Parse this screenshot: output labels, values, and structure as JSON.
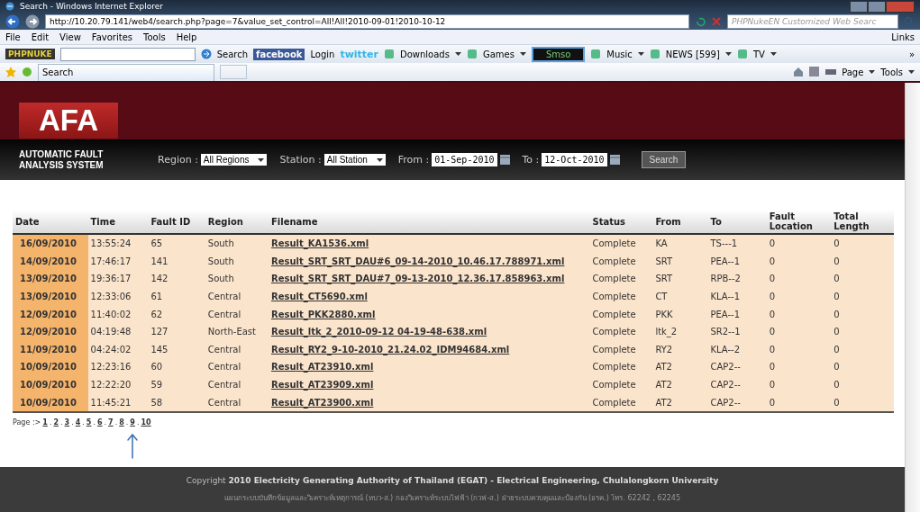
{
  "window": {
    "title": "Search - Windows Internet Explorer"
  },
  "address_bar": {
    "url": "http://10.20.79.141/web4/search.php?page=7&value_set_control=All!All!2010-09-01!2010-10-12",
    "search_placeholder": "PHPNukeEN Customized Web Searc"
  },
  "menu": [
    "File",
    "Edit",
    "View",
    "Favorites",
    "Tools",
    "Help"
  ],
  "menu_links": "Links",
  "toolbar": {
    "logo": "PHPNUKE",
    "items": [
      {
        "kind": "search",
        "label": "Search"
      },
      {
        "kind": "facebook",
        "label": "facebook"
      },
      {
        "kind": "text",
        "label": "Login"
      },
      {
        "kind": "twitter",
        "label": "twitter"
      },
      {
        "kind": "menu",
        "label": "Downloads"
      },
      {
        "kind": "menu",
        "label": "Games"
      },
      {
        "kind": "radio",
        "label": "Smso"
      },
      {
        "kind": "menu",
        "label": "Music"
      },
      {
        "kind": "menu",
        "label": "NEWS [599]"
      },
      {
        "kind": "menu",
        "label": "TV"
      }
    ],
    "more": "»"
  },
  "tab": {
    "label": "Search"
  },
  "command_bar": [
    "Page",
    "Tools"
  ],
  "header": {
    "logo": "AFA",
    "subtitle": "AUTOMATIC FAULT ANALYSIS SYSTEM",
    "filters": [
      {
        "label": "Region :",
        "kind": "select",
        "value": "All Regions"
      },
      {
        "label": "Station :",
        "kind": "select",
        "value": "All Station"
      },
      {
        "label": "From :",
        "kind": "date",
        "value": "01-Sep-2010"
      },
      {
        "label": "To :",
        "kind": "date",
        "value": "12-Oct-2010"
      }
    ],
    "search_button": "Search"
  },
  "table": {
    "columns": [
      "Date",
      "Time",
      "Fault ID",
      "Region",
      "Filename",
      "Status",
      "From",
      "To",
      "Fault Location",
      "Total Length"
    ],
    "rows": [
      [
        "16/09/2010",
        "13:55:24",
        "65",
        "South",
        "Result_KA1536.xml",
        "Complete",
        "KA",
        "TS---1",
        "0",
        "0"
      ],
      [
        "14/09/2010",
        "17:46:17",
        "141",
        "South",
        "Result_SRT_SRT_DAU#6_09-14-2010_10.46.17.788971.xml",
        "Complete",
        "SRT",
        "PEA--1",
        "0",
        "0"
      ],
      [
        "13/09/2010",
        "19:36:17",
        "142",
        "South",
        "Result_SRT_SRT_DAU#7_09-13-2010_12.36.17.858963.xml",
        "Complete",
        "SRT",
        "RPB--2",
        "0",
        "0"
      ],
      [
        "13/09/2010",
        "12:33:06",
        "61",
        "Central",
        "Result_CT5690.xml",
        "Complete",
        "CT",
        "KLA--1",
        "0",
        "0"
      ],
      [
        "12/09/2010",
        "11:40:02",
        "62",
        "Central",
        "Result_PKK2880.xml",
        "Complete",
        "PKK",
        "PEA--1",
        "0",
        "0"
      ],
      [
        "12/09/2010",
        "04:19:48",
        "127",
        "North-East",
        "Result_ltk_2_2010-09-12 04-19-48-638.xml",
        "Complete",
        "ltk_2",
        "SR2--1",
        "0",
        "0"
      ],
      [
        "11/09/2010",
        "04:24:02",
        "145",
        "Central",
        "Result_RY2_9-10-2010_21.24.02_IDM94684.xml",
        "Complete",
        "RY2",
        "KLA--2",
        "0",
        "0"
      ],
      [
        "10/09/2010",
        "12:23:16",
        "60",
        "Central",
        "Result_AT23910.xml",
        "Complete",
        "AT2",
        "CAP2--",
        "0",
        "0"
      ],
      [
        "10/09/2010",
        "12:22:20",
        "59",
        "Central",
        "Result_AT23909.xml",
        "Complete",
        "AT2",
        "CAP2--",
        "0",
        "0"
      ],
      [
        "10/09/2010",
        "11:45:21",
        "58",
        "Central",
        "Result_AT23900.xml",
        "Complete",
        "AT2",
        "CAP2--",
        "0",
        "0"
      ]
    ]
  },
  "pagination": {
    "label": "Page :>",
    "separator": ".",
    "pages": [
      "1",
      "2",
      "3",
      "4",
      "5",
      "6",
      "7",
      "8",
      "9",
      "10"
    ]
  },
  "footer": {
    "copyright": "Copyright **2010 Electricity Generating Authority of Thailand (EGAT) - Electrical Engineering, Chulalongkorn University**",
    "contact": "แผนกระบบบันทึกข้อมูลและวิเคราะห์เหตุการณ์ (หบว-ส.) กองวิเคราะห์ระบบไฟฟ้า (กวฟ-ส.) ฝ่ายระบบควบคุมและป้องกัน (อรค.) โทร. 62242 , 62245"
  }
}
